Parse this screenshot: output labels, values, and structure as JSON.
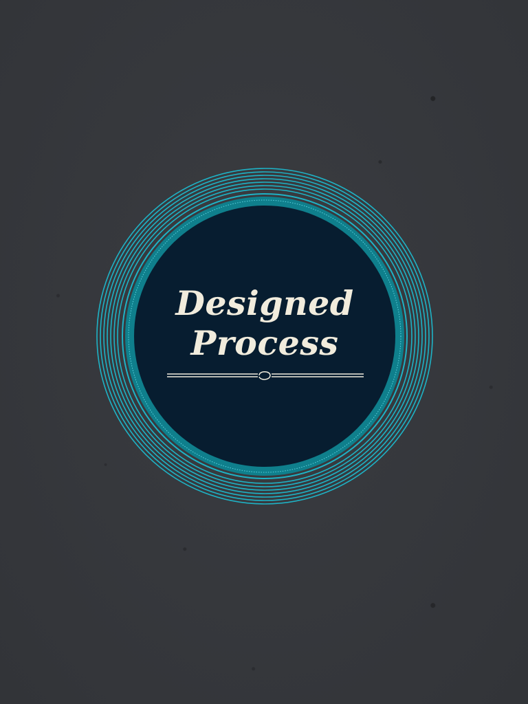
{
  "badge": {
    "title_line1": "Designed",
    "title_line2": "Process"
  },
  "colors": {
    "background": "#36383d",
    "ring_accent": "#1eb3c6",
    "ring_inner": "#0f7f8c",
    "disc": "#071d30",
    "title_text": "#f1ecdd"
  }
}
